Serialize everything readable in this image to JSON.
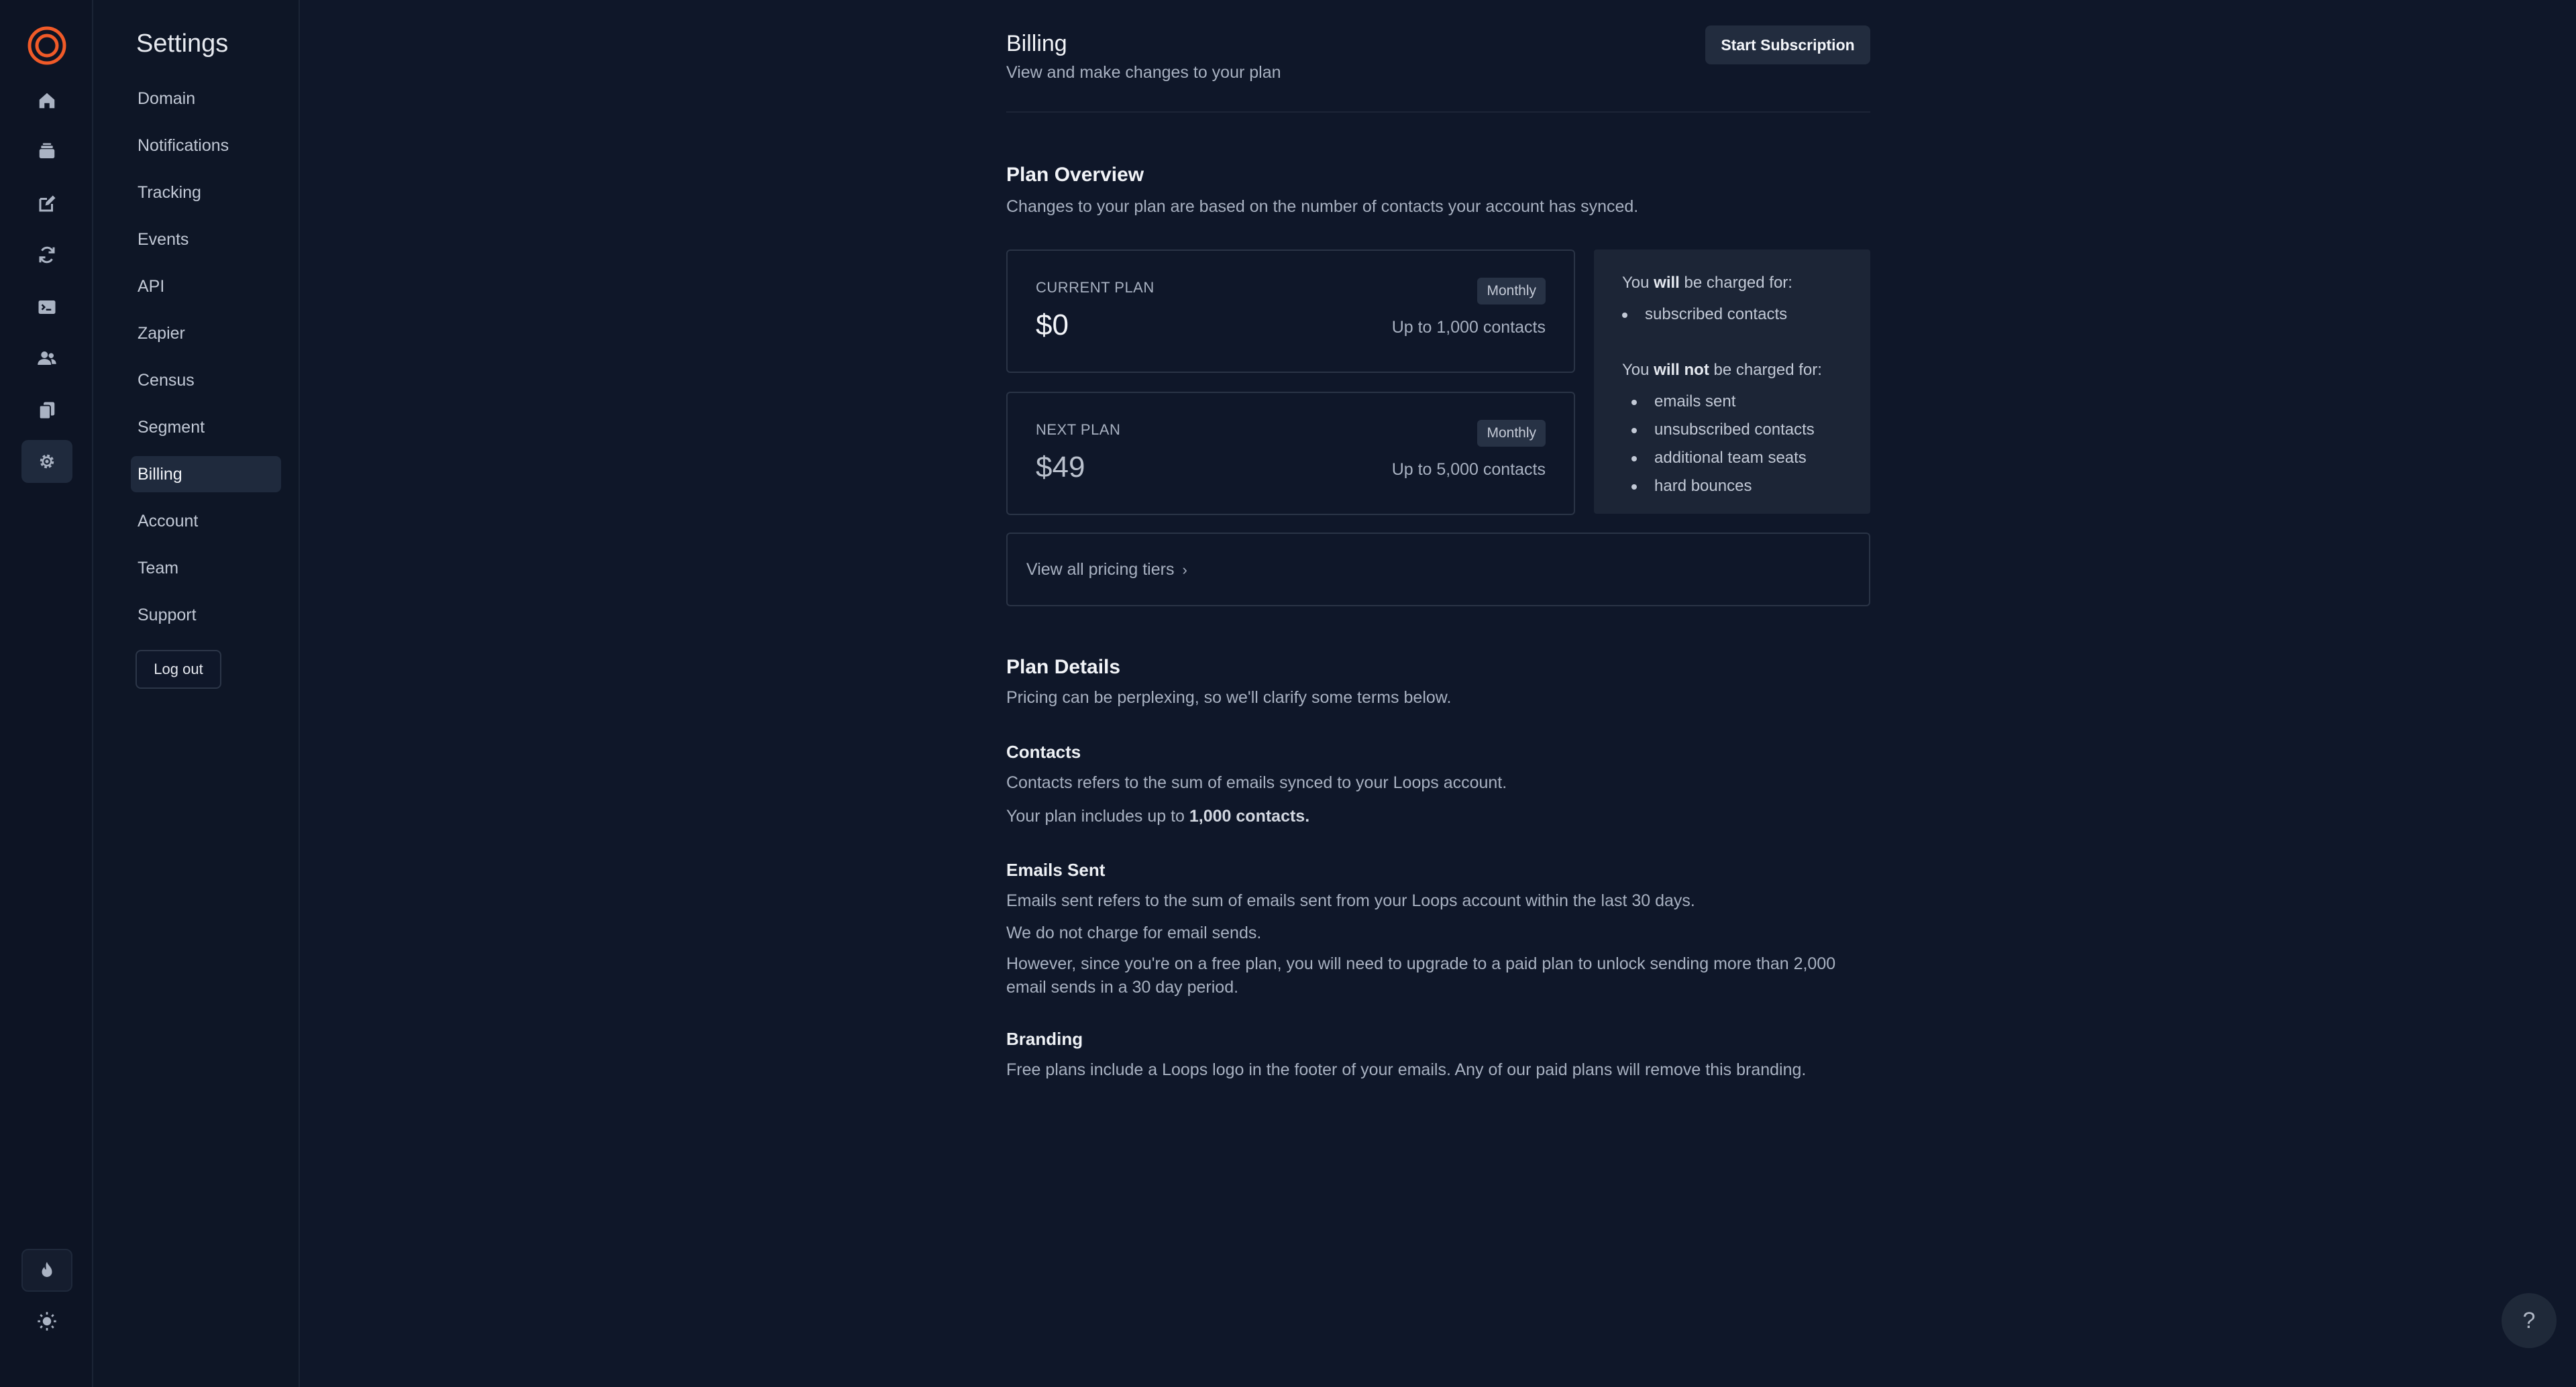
{
  "rail": {
    "items": [
      {
        "name": "home-icon"
      },
      {
        "name": "campaigns-icon"
      },
      {
        "name": "edit-icon"
      },
      {
        "name": "loops-icon"
      },
      {
        "name": "transactional-icon"
      },
      {
        "name": "audience-icon"
      },
      {
        "name": "templates-icon"
      },
      {
        "name": "settings-icon"
      }
    ],
    "bottom": [
      {
        "name": "flame-icon"
      },
      {
        "name": "sun-icon"
      }
    ]
  },
  "sidebar": {
    "title": "Settings",
    "items": [
      {
        "label": "Domain"
      },
      {
        "label": "Notifications"
      },
      {
        "label": "Tracking"
      },
      {
        "label": "Events"
      },
      {
        "label": "API"
      },
      {
        "label": "Zapier"
      },
      {
        "label": "Census"
      },
      {
        "label": "Segment"
      },
      {
        "label": "Billing",
        "active": true
      },
      {
        "label": "Account"
      },
      {
        "label": "Team"
      },
      {
        "label": "Support"
      }
    ],
    "logout_label": "Log out"
  },
  "header": {
    "title": "Billing",
    "subtitle": "View and make changes to your plan",
    "start_subscription_label": "Start Subscription"
  },
  "overview": {
    "title": "Plan Overview",
    "subtitle": "Changes to your plan are based on the number of contacts your account has synced.",
    "current_plan": {
      "label": "CURRENT PLAN",
      "price": "$0",
      "cycle": "Monthly",
      "limit": "Up to 1,000 contacts"
    },
    "next_plan": {
      "label": "NEXT PLAN",
      "price": "$49",
      "cycle": "Monthly",
      "limit": "Up to 5,000 contacts"
    },
    "charges": {
      "will_prefix": "You ",
      "will_word": "will",
      "will_suffix": " be charged for:",
      "will_items": [
        "subscribed contacts"
      ],
      "will_not_prefix": "You ",
      "will_not_word": "will not",
      "will_not_suffix": " be charged for:",
      "will_not_items": [
        "emails sent",
        "unsubscribed contacts",
        "additional team seats",
        "hard bounces"
      ]
    },
    "tiers_link": "View all pricing tiers",
    "tiers_chevron": "›"
  },
  "details": {
    "title": "Plan Details",
    "subtitle": "Pricing can be perplexing, so we'll clarify some terms below.",
    "contacts": {
      "title": "Contacts",
      "line1": "Contacts refers to the sum of emails synced to your Loops account.",
      "line2_prefix": "Your plan includes up to ",
      "line2_bold": "1,000 contacts."
    },
    "emails": {
      "title": "Emails Sent",
      "line1": "Emails sent refers to the sum of emails sent from your Loops account within the last 30 days.",
      "line2": "We do not charge for email sends.",
      "line3": "However, since you're on a free plan, you will need to upgrade to a paid plan to unlock sending more than 2,000 email sends in a 30 day period."
    },
    "branding": {
      "title": "Branding",
      "line1": "Free plans include a Loops logo in the footer of your emails. Any of our paid plans will remove this branding."
    }
  },
  "help": {
    "label": "?"
  },
  "colors": {
    "accent": "#f05a28",
    "background": "#0f1729",
    "panel": "#1c2536"
  }
}
